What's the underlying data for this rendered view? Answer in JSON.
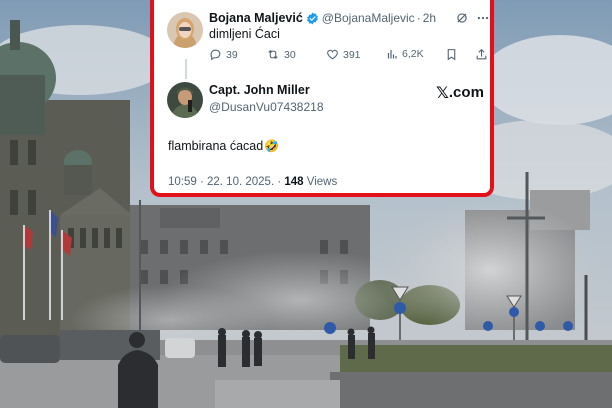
{
  "tweet1": {
    "display_name": "Bojana Maljević",
    "handle": "@BojanaMaljevic",
    "time_ago": "2h",
    "text": "dimljeni Ćaci",
    "actions": {
      "replies": "39",
      "reposts": "30",
      "likes": "391",
      "views": "6,2K"
    }
  },
  "tweet2": {
    "display_name": "Capt. John Miller",
    "handle": "@DusanVu07438218",
    "text": "flambirana ćacad",
    "emoji": "🤣",
    "timestamp": "10:59 · 22. 10. 2025.",
    "views_count": "148",
    "views_label": "Views"
  },
  "brand": {
    "x_letter": "𝕏",
    "domain": ".com"
  },
  "colors": {
    "highlight_border": "#e3101a",
    "verified": "#1d9bf0"
  }
}
